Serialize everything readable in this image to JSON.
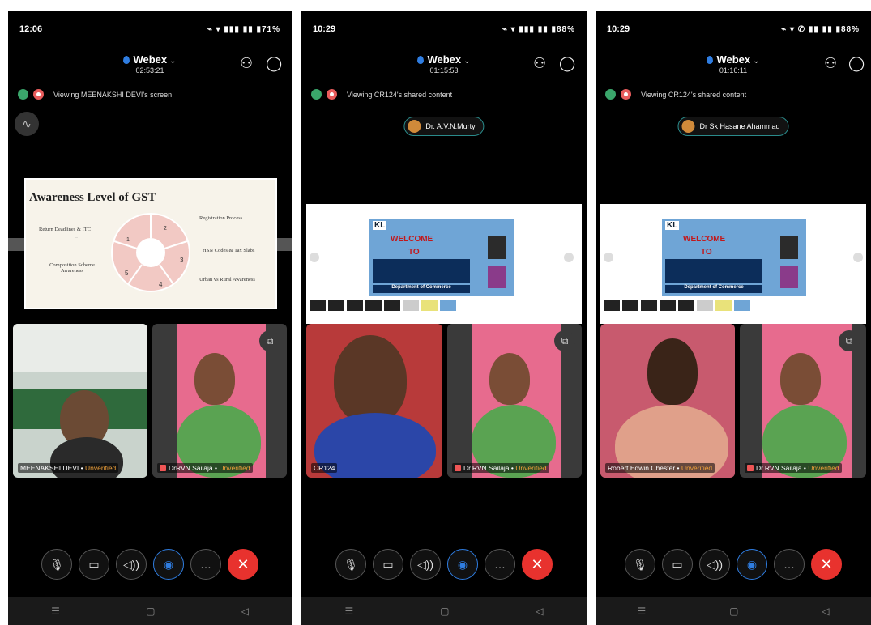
{
  "phones": [
    {
      "status_time": "12:06",
      "status_icons": "⌁ ▾ ▮▮▮ ▮▮ ▮71%",
      "app_title": "Webex",
      "timer": "02:53:21",
      "viewing_text": "Viewing MEENAKSHI DEVI's screen",
      "slide": {
        "title": "Awareness Level of GST",
        "left_items": [
          "Return Deadlines & ITC",
          "Composition Scheme Awareness"
        ],
        "right_items": [
          "Registration Process",
          "HSN Codes & Tax Slabs",
          "Urban vs Rural Awareness"
        ],
        "pie_numbers": [
          "1",
          "2",
          "3",
          "4",
          "5"
        ]
      },
      "tiles": [
        {
          "name": "MEENAKSHI DEVI",
          "status": "Unverified"
        },
        {
          "name": "DrRVN Sailaja",
          "status": "Unverified"
        }
      ]
    },
    {
      "status_time": "10:29",
      "status_icons": "⌁ ▾ ▮▮▮ ▮▮ ▮88%",
      "app_title": "Webex",
      "timer": "01:15:53",
      "viewing_text": "Viewing CR124's shared content",
      "presenter": "Dr. A.V.N.Murty",
      "banner_logo": "KL",
      "banner_welcome": "WELCOME",
      "banner_to": "TO",
      "banner_dept": "Department of Commerce",
      "tiles": [
        {
          "name": "CR124",
          "status": ""
        },
        {
          "name": "Dr.RVN Sailaja",
          "status": "Unverified"
        }
      ]
    },
    {
      "status_time": "10:29",
      "status_icons": "⌁ ▾ ✆ ▮▮ ▮▮ ▮88%",
      "app_title": "Webex",
      "timer": "01:16:11",
      "viewing_text": "Viewing CR124's shared content",
      "presenter": "Dr Sk Hasane Ahammad",
      "banner_logo": "KL",
      "banner_welcome": "WELCOME",
      "banner_to": "TO",
      "banner_dept": "Department of Commerce",
      "tiles": [
        {
          "name": "Robert Edwin Chester",
          "status": "Unverified"
        },
        {
          "name": "Dr.RVN Sailaja",
          "status": "Unverified"
        }
      ]
    }
  ],
  "separator": "•",
  "icons": {
    "participants": "participants-icon",
    "chat": "chat-icon",
    "mute": "mic-off-icon",
    "video": "video-icon",
    "audio": "speaker-icon",
    "ai": "assistant-icon",
    "more": "more-icon",
    "end": "end-call-icon"
  },
  "colors": {
    "end_call": "#e8322e",
    "accent": "#2f7de1",
    "unverified": "#f0a13a"
  }
}
